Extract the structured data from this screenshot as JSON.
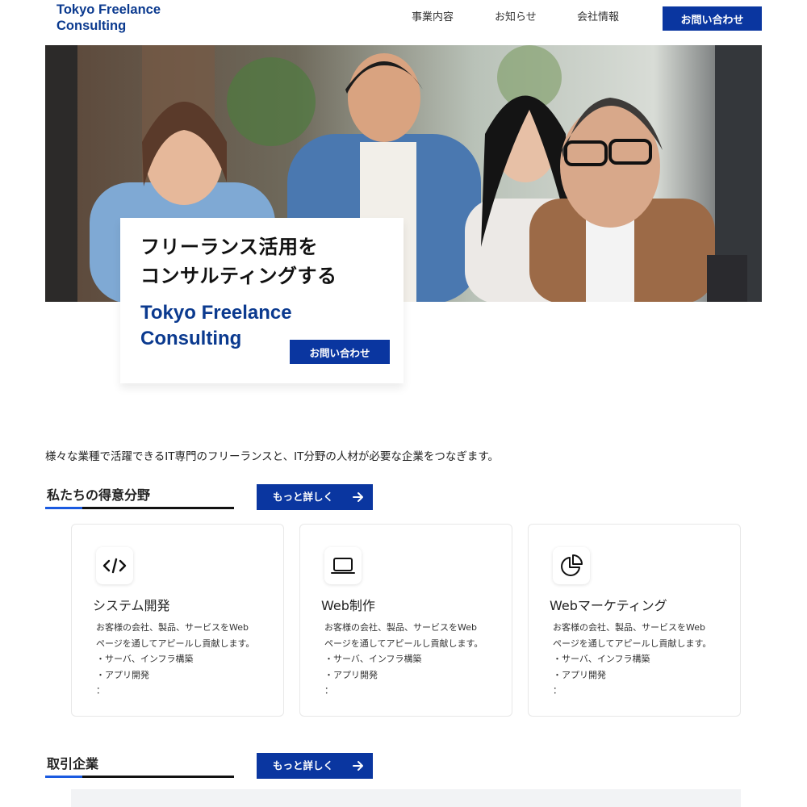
{
  "header": {
    "logo_line1": "Tokyo Freelance",
    "logo_line2": "Consulting",
    "nav": [
      "事業内容",
      "お知らせ",
      "会社情報"
    ],
    "cta_label": "お問い合わせ"
  },
  "hero": {
    "title_line1": "フリーランス活用を",
    "title_line2": "コンサルティングする",
    "brand_line1": "Tokyo Freelance",
    "brand_line2": "Consulting",
    "cta_label": "お問い合わせ"
  },
  "intro": "様々な業種で活躍できるIT専門のフリーランスと、IT分野の人材が必要な企業をつなぎます。",
  "specialties": {
    "title": "私たちの得意分野",
    "more_label": "もっと詳しく",
    "cards": [
      {
        "icon": "code-icon",
        "title": "システム開発",
        "lines": [
          "お客様の会社、製品、サービスをWeb",
          "ページを通してアピールし貢献します。",
          "・サーバ、インフラ構築",
          "・アプリ開発",
          "："
        ]
      },
      {
        "icon": "laptop-icon",
        "title": "Web制作",
        "lines": [
          "お客様の会社、製品、サービスをWeb",
          "ページを通してアピールし貢献します。",
          "・サーバ、インフラ構築",
          "・アプリ開発",
          "："
        ]
      },
      {
        "icon": "pie-chart-icon",
        "title": "Webマーケティング",
        "lines": [
          "お客様の会社、製品、サービスをWeb",
          "ページを通してアピールし貢献します。",
          "・サーバ、インフラ構築",
          "・アプリ開発",
          "："
        ]
      }
    ]
  },
  "partners": {
    "title": "取引企業",
    "more_label": "もっと詳しく"
  },
  "colors": {
    "brand_blue": "#0a36a0",
    "accent_blue": "#1a5ae0"
  }
}
